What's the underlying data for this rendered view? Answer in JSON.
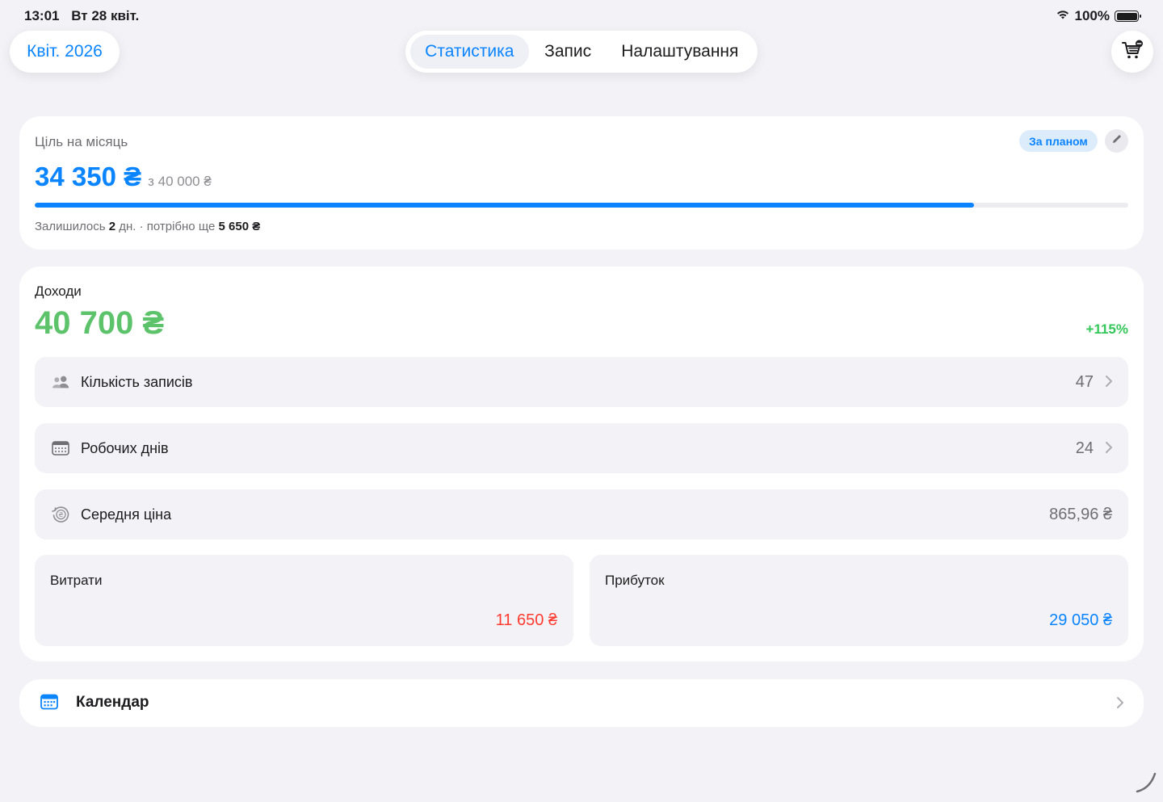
{
  "status_bar": {
    "time": "13:01",
    "date": "Вт 28 квіт.",
    "battery_percent": "100%",
    "battery_level": 1.0,
    "icons": [
      "wifi-icon",
      "battery-icon"
    ]
  },
  "header": {
    "month_label": "Квіт. 2026",
    "tabs": [
      {
        "label": "Статистика",
        "active": true
      },
      {
        "label": "Запис",
        "active": false
      },
      {
        "label": "Налаштування",
        "active": false
      }
    ],
    "cart_icon": "cart-icon"
  },
  "goal": {
    "title": "Ціль на місяць",
    "badge": "За планом",
    "current": "34 350 ₴",
    "target": "з 40 000 ₴",
    "progress": 0.859,
    "days_left_prefix": "Залишилось",
    "days_left_value": "2",
    "days_left_suffix": "дн. · потрібно ще",
    "remaining": "5 650 ₴",
    "accent_color": "#0a84ff"
  },
  "income": {
    "title": "Доходи",
    "value": "40 700 ₴",
    "change": "+115%",
    "color": "#5cc36a",
    "rows": [
      {
        "label": "Кількість записів",
        "value": "47",
        "icon": "people-icon"
      },
      {
        "label": "Робочих днів",
        "value": "24",
        "icon": "calendar-grid-icon"
      },
      {
        "label": "Середня ціна",
        "value": "865,96 ₴",
        "icon": "hryvnia-clock-icon"
      }
    ],
    "expenses": {
      "label": "Витрати",
      "value": "11 650 ₴",
      "color": "#ff3b30"
    },
    "profit": {
      "label": "Прибуток",
      "value": "29 050 ₴",
      "color": "#0a84ff"
    }
  },
  "calendar": {
    "label": "Календар",
    "icon": "calendar-icon"
  }
}
